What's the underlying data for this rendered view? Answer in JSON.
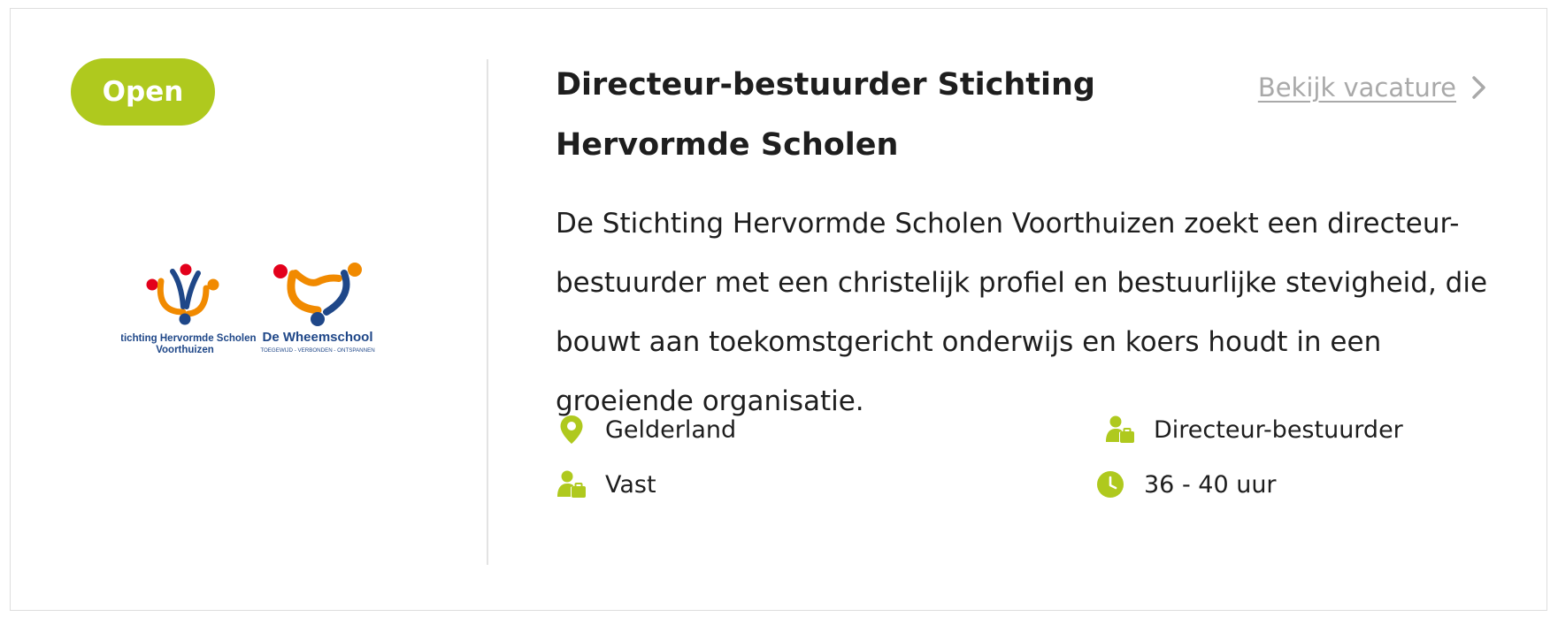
{
  "vacancy": {
    "status": "Open",
    "title": "Directeur-bestuurder Stichting Hervormde Scholen",
    "view_link": "Bekijk vacature",
    "description": "De Stichting Hervormde Scholen Voorthuizen zoekt een directeur-bestuurder met een christelijk profiel en bestuurlijke stevigheid, die bouwt aan toekomstgericht onderwijs en koers houdt in een groeiende organisatie.",
    "logo": {
      "org1_line1": "Stichting Hervormde Scholen",
      "org1_line2": "Voorthuizen",
      "org2_name": "De Wheemschool",
      "org2_tagline": "TOEGEWIJD - VERBONDEN - ONTSPANNEN"
    },
    "meta": {
      "location": {
        "icon": "location-pin-icon",
        "value": "Gelderland"
      },
      "function": {
        "icon": "person-briefcase-icon",
        "value": "Directeur-bestuurder"
      },
      "contract": {
        "icon": "person-briefcase-icon",
        "value": "Vast"
      },
      "hours": {
        "icon": "clock-icon",
        "value": "36 - 40 uur"
      }
    }
  },
  "colors": {
    "accent": "#afc91e",
    "text": "#1e1e1e",
    "muted": "#a9a9a9",
    "logo_blue": "#1f4788",
    "logo_orange": "#f18a00",
    "logo_red": "#e3001b"
  }
}
